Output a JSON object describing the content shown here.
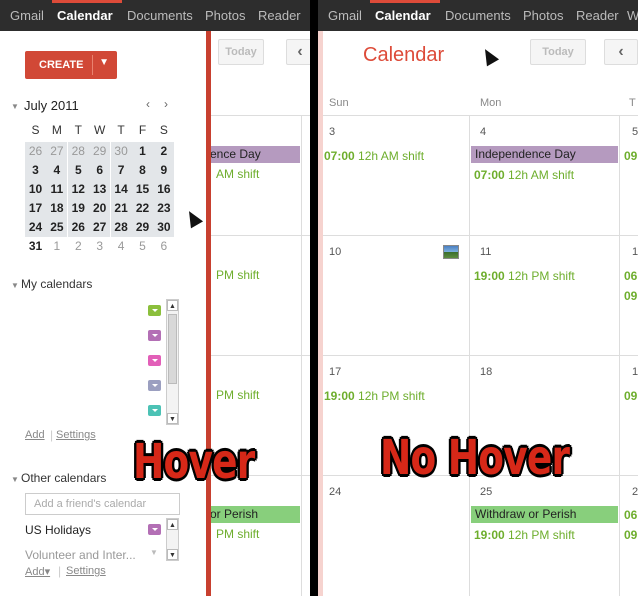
{
  "nav": {
    "items": [
      "Gmail",
      "Calendar",
      "Documents",
      "Photos",
      "Reader",
      "W"
    ],
    "active": "Calendar"
  },
  "sidebar": {
    "create_label": "CREATE",
    "month_title": "July 2011",
    "prev_label": "‹",
    "next_label": "›",
    "weekdays": [
      "S",
      "M",
      "T",
      "W",
      "T",
      "F",
      "S"
    ],
    "weeks": [
      [
        "26",
        "27",
        "28",
        "29",
        "30",
        "1",
        "2"
      ],
      [
        "3",
        "4",
        "5",
        "6",
        "7",
        "8",
        "9"
      ],
      [
        "10",
        "11",
        "12",
        "13",
        "14",
        "15",
        "16"
      ],
      [
        "17",
        "18",
        "19",
        "20",
        "21",
        "22",
        "23"
      ],
      [
        "24",
        "25",
        "26",
        "27",
        "28",
        "29",
        "30"
      ],
      [
        "31",
        "1",
        "2",
        "3",
        "4",
        "5",
        "6"
      ]
    ],
    "my_calendars_title": "My calendars",
    "add_link": "Add",
    "settings_link": "Settings",
    "other_calendars_title": "Other calendars",
    "friend_placeholder": "Add a friend's calendar",
    "other_items": [
      "US Holidays",
      "Volunteer and Inter..."
    ],
    "add_menu_link": "Add▾",
    "other_settings_link": "Settings",
    "swatch_colors": [
      "#8bbf3c",
      "#b36fb5",
      "#e25fb8",
      "#9b9fc0",
      "#4cc2b5"
    ],
    "other_swatch_colors": [
      "#b36fb5"
    ]
  },
  "toolbar": {
    "title": "Calendar",
    "today_label": "Today",
    "prev_label": "‹"
  },
  "left_grid": {
    "events": [
      {
        "label": "ence Day"
      },
      {
        "time": "",
        "text": "AM shift"
      },
      {
        "time": "",
        "text": "PM shift"
      },
      {
        "time": "",
        "text": "PM shift"
      },
      {
        "label": "or Perish"
      },
      {
        "time": "",
        "text": "PM shift"
      }
    ]
  },
  "right_grid": {
    "day_headers": [
      "Sun",
      "Mon",
      "T"
    ],
    "dates": [
      "3",
      "4",
      "5",
      "10",
      "11",
      "1",
      "17",
      "18",
      "1",
      "24",
      "25",
      "2"
    ],
    "holiday_label": "Independence Day",
    "shift_am": {
      "time": "07:00",
      "text": "12h AM shift"
    },
    "shift_pm": {
      "time": "19:00",
      "text": "12h PM shift"
    },
    "withdraw_label": "Withdraw or Perish",
    "edge_times": [
      "09",
      "06",
      "09",
      "09",
      "06",
      "09"
    ]
  },
  "overlays": {
    "hover": "Hover",
    "no_hover": "No Hover"
  },
  "colors": {
    "holiday": "#b59abf",
    "withdraw": "#88cf7c",
    "event_text": "#6eae2d",
    "create": "#d14836",
    "accent": "#dd4b39"
  }
}
